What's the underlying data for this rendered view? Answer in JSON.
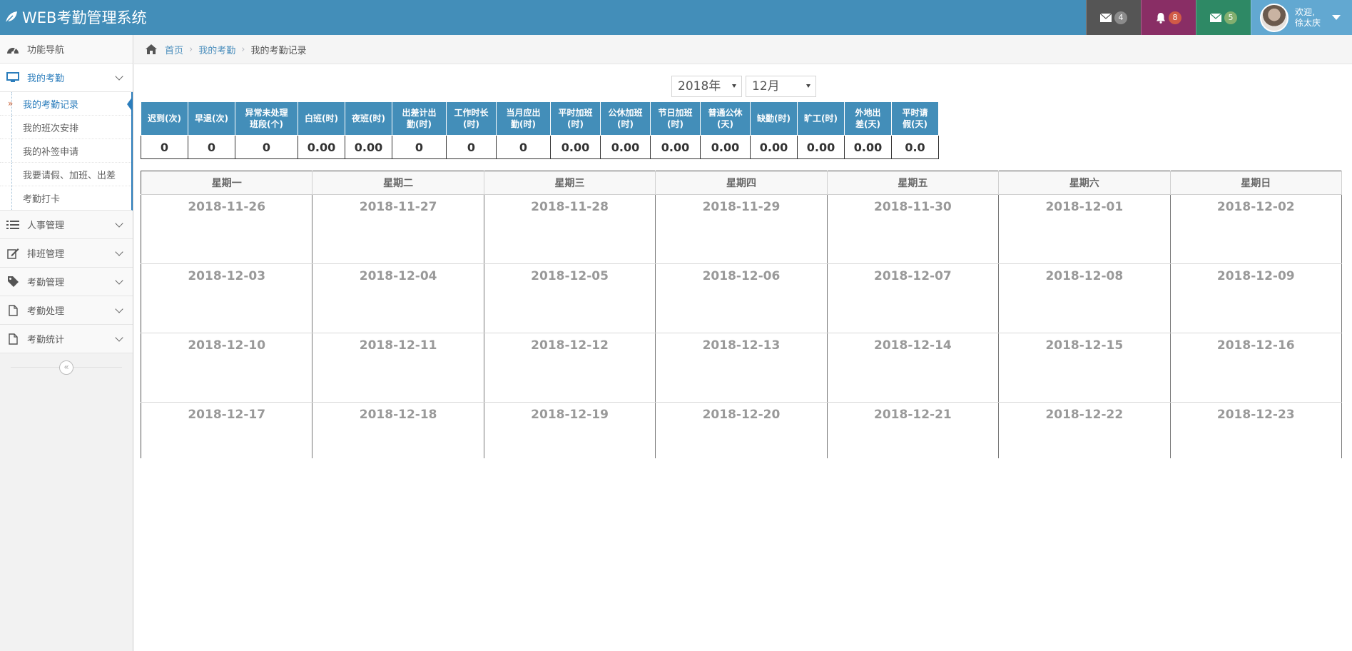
{
  "app": {
    "title": "WEB考勤管理系统"
  },
  "header": {
    "messages_count": "4",
    "notifications_count": "8",
    "mail_count": "5",
    "welcome": "欢迎,",
    "user_name": "徐太庆"
  },
  "sidebar": {
    "nav_label": "功能导航",
    "items": [
      {
        "label": "我的考勤",
        "icon": "monitor-icon"
      },
      {
        "label": "人事管理",
        "icon": "list-icon"
      },
      {
        "label": "排班管理",
        "icon": "edit-icon"
      },
      {
        "label": "考勤管理",
        "icon": "tag-icon"
      },
      {
        "label": "考勤处理",
        "icon": "file-icon"
      },
      {
        "label": "考勤统计",
        "icon": "file-icon"
      }
    ],
    "submenu": [
      "我的考勤记录",
      "我的班次安排",
      "我的补签申请",
      "我要请假、加班、出差",
      "考勤打卡"
    ]
  },
  "breadcrumb": {
    "home": "首页",
    "parent": "我的考勤",
    "current": "我的考勤记录"
  },
  "filters": {
    "year": "2018年",
    "month": "12月"
  },
  "stats": {
    "headers": [
      [
        "迟到(次)"
      ],
      [
        "早退(次)"
      ],
      [
        "异常未处理",
        "班段(个)"
      ],
      [
        "白班(时)"
      ],
      [
        "夜班(时)"
      ],
      [
        "出差计出",
        "勤(时)"
      ],
      [
        "工作时长",
        "(时)"
      ],
      [
        "当月应出",
        "勤(时)"
      ],
      [
        "平时加班",
        "(时)"
      ],
      [
        "公休加班",
        "(时)"
      ],
      [
        "节日加班",
        "(时)"
      ],
      [
        "普通公休",
        "(天)"
      ],
      [
        "缺勤(时)"
      ],
      [
        "旷工(时)"
      ],
      [
        "外地出",
        "差(天)"
      ],
      [
        "平时请",
        "假(天)"
      ]
    ],
    "values": [
      "0",
      "0",
      "0",
      "0.00",
      "0.00",
      "0",
      "0",
      "0",
      "0.00",
      "0.00",
      "0.00",
      "0.00",
      "0.00",
      "0.00",
      "0.00",
      "0.0"
    ]
  },
  "calendar": {
    "weekdays": [
      "星期一",
      "星期二",
      "星期三",
      "星期四",
      "星期五",
      "星期六",
      "星期日"
    ],
    "weeks": [
      [
        "2018-11-26",
        "2018-11-27",
        "2018-11-28",
        "2018-11-29",
        "2018-11-30",
        "2018-12-01",
        "2018-12-02"
      ],
      [
        "2018-12-03",
        "2018-12-04",
        "2018-12-05",
        "2018-12-06",
        "2018-12-07",
        "2018-12-08",
        "2018-12-09"
      ],
      [
        "2018-12-10",
        "2018-12-11",
        "2018-12-12",
        "2018-12-13",
        "2018-12-14",
        "2018-12-15",
        "2018-12-16"
      ],
      [
        "2018-12-17",
        "2018-12-18",
        "2018-12-19",
        "2018-12-20",
        "2018-12-21",
        "2018-12-22",
        "2018-12-23"
      ]
    ]
  },
  "colors": {
    "header": "#438eb9",
    "accent": "#2b7dbc",
    "grey_box": "#555555",
    "purple_box": "#892e65",
    "green_box": "#2e8965"
  }
}
